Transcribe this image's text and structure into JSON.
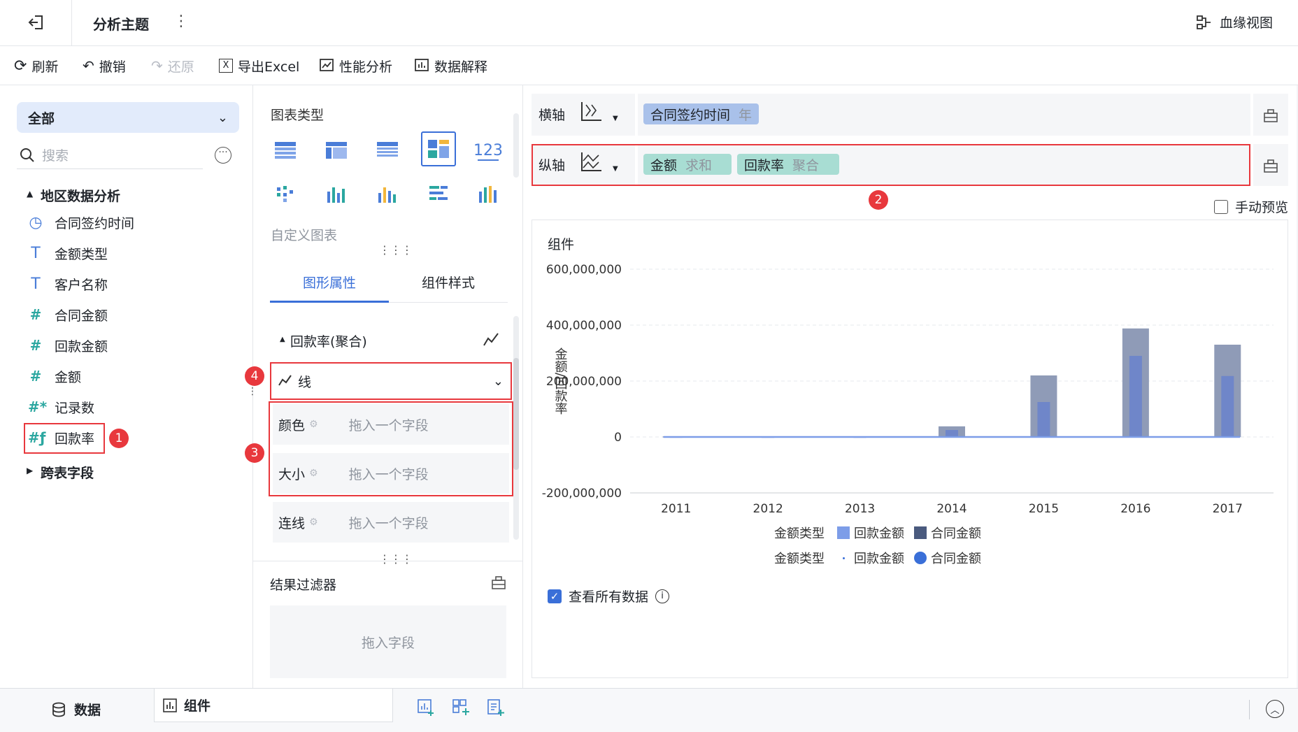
{
  "topbar": {
    "title": "分析主题",
    "lineage": "血缘视图"
  },
  "toolbar": {
    "refresh": "刷新",
    "undo": "撤销",
    "redo": "还原",
    "export": "导出Excel",
    "perf": "性能分析",
    "explain": "数据解释"
  },
  "left": {
    "scope": "全部",
    "search_placeholder": "搜索",
    "group": "地区数据分析",
    "fields": [
      {
        "label": "合同签约时间",
        "icon": "clock-icon"
      },
      {
        "label": "金额类型",
        "icon": "text-type-icon"
      },
      {
        "label": "客户名称",
        "icon": "text-type-icon"
      },
      {
        "label": "合同金额",
        "icon": "number-type-icon"
      },
      {
        "label": "回款金额",
        "icon": "number-type-icon"
      },
      {
        "label": "金额",
        "icon": "number-type-icon"
      },
      {
        "label": "记录数",
        "icon": "record-count-icon"
      },
      {
        "label": "回款率",
        "icon": "calculated-field-icon"
      }
    ],
    "cross_group": "跨表字段"
  },
  "middle": {
    "chart_types_label": "图表类型",
    "custom_chart": "自定义图表",
    "tab_shape": "图形属性",
    "tab_style": "组件样式",
    "series_label": "回款率(聚合)",
    "shape_select": "线",
    "attrs": [
      {
        "label": "颜色",
        "placeholder": "拖入一个字段"
      },
      {
        "label": "大小",
        "placeholder": "拖入一个字段"
      },
      {
        "label": "连线",
        "placeholder": "拖入一个字段"
      }
    ],
    "filter_label": "结果过滤器",
    "filter_drop": "拖入字段"
  },
  "axes": {
    "x_label": "横轴",
    "y_label": "纵轴",
    "x_chip": {
      "name": "合同签约时间",
      "agg": "年"
    },
    "y_chips": [
      {
        "name": "金额",
        "agg": "求和"
      },
      {
        "name": "回款率",
        "agg": "聚合"
      }
    ],
    "manual_preview": "手动预览"
  },
  "badges": [
    "1",
    "2",
    "3",
    "4"
  ],
  "chart": {
    "component_title": "组件",
    "view_all": "查看所有数据"
  },
  "chart_data": {
    "type": "bar",
    "title": "",
    "categories": [
      "2011",
      "2012",
      "2013",
      "2014",
      "2015",
      "2016",
      "2017"
    ],
    "ylabel": "金额/回款率",
    "y_ticks": [
      "600,000,000",
      "400,000,000",
      "200,000,000",
      "0",
      "-200,000,000"
    ],
    "ylim": [
      -200000000,
      600000000
    ],
    "series": [
      {
        "name": "合同金额",
        "color": "#8f9bb7",
        "values": [
          2000000,
          1500000,
          1500000,
          38000000,
          220000000,
          388000000,
          330000000
        ]
      },
      {
        "name": "回款金额",
        "color": "#6f86c9",
        "values": [
          1000000,
          800000,
          800000,
          25000000,
          125000000,
          290000000,
          218000000
        ]
      }
    ],
    "line_series": {
      "name": "回款率",
      "color": "#7d9de8"
    },
    "legend_title": "金额类型",
    "legend_bar": [
      "回款金额",
      "合同金额"
    ],
    "legend_line": [
      "回款金额",
      "合同金额"
    ]
  },
  "bottom": {
    "data_tab": "数据",
    "component_tab": "组件"
  },
  "colors": {
    "accent": "#3a6fd8",
    "red": "#e8383d",
    "teal": "#2ba7a0"
  }
}
